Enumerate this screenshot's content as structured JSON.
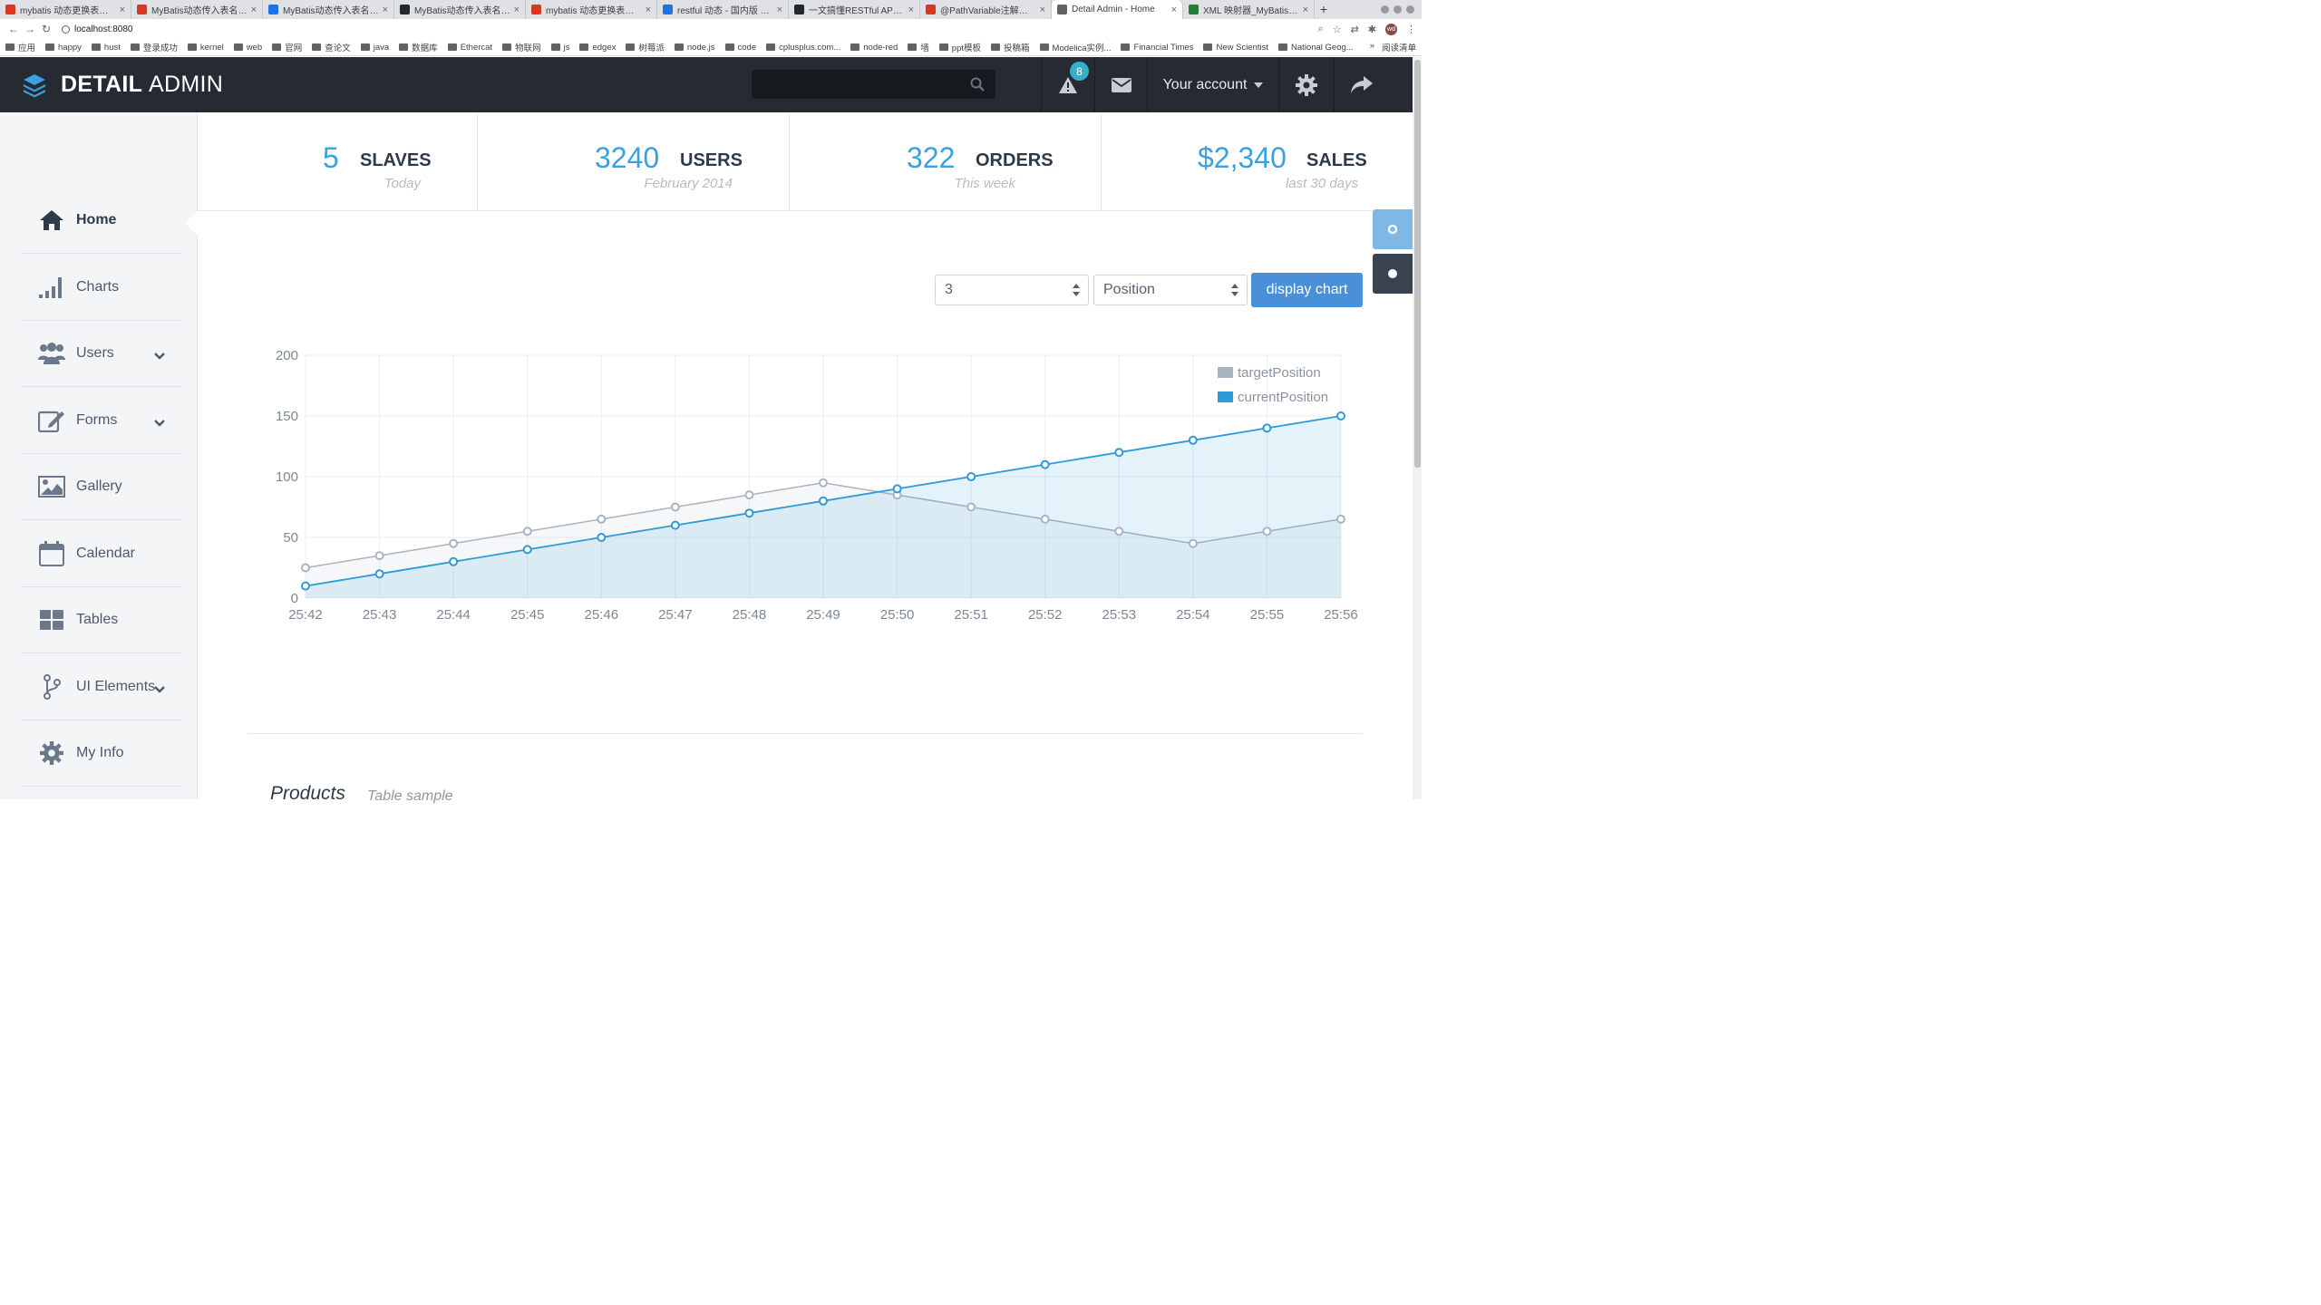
{
  "browser": {
    "tabs": [
      {
        "label": "mybatis 动态更换表名，J",
        "color": "#d9381e"
      },
      {
        "label": "MyBatis动态传入表名_da",
        "color": "#d9381e"
      },
      {
        "label": "MyBatis动态传入表名 - 图",
        "color": "#1a73e8"
      },
      {
        "label": "MyBatis动态传入表名 - cn",
        "color": "#24292e"
      },
      {
        "label": "mybatis 动态更换表名，J",
        "color": "#d9381e"
      },
      {
        "label": "restful 动态 - 国内版 Bing",
        "color": "#1a73e8"
      },
      {
        "label": "一文搞懂RESTful API - big",
        "color": "#24292e"
      },
      {
        "label": "@PathVariable注解使用_",
        "color": "#d9381e"
      },
      {
        "label": "Detail Admin - Home",
        "color": "#5f6368",
        "active": true
      },
      {
        "label": "XML 映射器_MyBatis中文",
        "color": "#1e7f3a"
      }
    ],
    "url": "localhost:8080",
    "bookmarks": [
      "应用",
      "happy",
      "hust",
      "登录成功",
      "kernel",
      "web",
      "官网",
      "查论文",
      "java",
      "数据库",
      "Ethercat",
      "物联网",
      "js",
      "edgex",
      "树莓派",
      "node.js",
      "code",
      "cplusplus.com...",
      "node-red",
      "墙",
      "ppt模板",
      "投稿箱",
      "Modelica实例...",
      "Financial Times",
      "New Scientist",
      "National Geog..."
    ],
    "bookmarks_more": "»",
    "reading_list": "阅读清单",
    "profile_initials": "wd"
  },
  "header": {
    "brand_bold": "DETAIL",
    "brand_light": "ADMIN",
    "search_placeholder": "",
    "alert_count": "8",
    "account_label": "Your account"
  },
  "sidebar": {
    "items": [
      {
        "label": "Home",
        "icon": "home-icon",
        "active": true
      },
      {
        "label": "Charts",
        "icon": "charts-icon"
      },
      {
        "label": "Users",
        "icon": "users-icon",
        "has_submenu": true
      },
      {
        "label": "Forms",
        "icon": "forms-icon",
        "has_submenu": true
      },
      {
        "label": "Gallery",
        "icon": "gallery-icon"
      },
      {
        "label": "Calendar",
        "icon": "calendar-icon"
      },
      {
        "label": "Tables",
        "icon": "tables-icon"
      },
      {
        "label": "UI Elements",
        "icon": "ui-elements-icon",
        "has_submenu": true
      },
      {
        "label": "My Info",
        "icon": "gear-icon"
      }
    ]
  },
  "stats": [
    {
      "value": "5",
      "label": "SLAVES",
      "sub": "Today"
    },
    {
      "value": "3240",
      "label": "USERS",
      "sub": "February 2014"
    },
    {
      "value": "322",
      "label": "ORDERS",
      "sub": "This week"
    },
    {
      "value": "$2,340",
      "label": "SALES",
      "sub": "last 30 days"
    }
  ],
  "controls": {
    "count_select": "3",
    "type_select": "Position",
    "display_button": "display chart"
  },
  "colors": {
    "accent": "#3aa0df",
    "header_bg": "#262b33",
    "button": "#4a90d9",
    "target_series": "#a9b4c2",
    "current_series": "#2e9ad8"
  },
  "chart_data": {
    "type": "line",
    "x": [
      "25:42",
      "25:43",
      "25:44",
      "25:45",
      "25:46",
      "25:47",
      "25:48",
      "25:49",
      "25:50",
      "25:51",
      "25:52",
      "25:53",
      "25:54",
      "25:55",
      "25:56"
    ],
    "ylim": [
      0,
      200
    ],
    "yticks": [
      0,
      50,
      100,
      150,
      200
    ],
    "grid": true,
    "legend_position": "top-right",
    "series": [
      {
        "name": "targetPosition",
        "values": [
          25,
          35,
          45,
          55,
          65,
          75,
          85,
          95,
          85,
          75,
          65,
          55,
          45,
          55,
          65
        ]
      },
      {
        "name": "currentPosition",
        "values": [
          10,
          20,
          30,
          40,
          50,
          60,
          70,
          80,
          90,
          100,
          110,
          120,
          130,
          140,
          150
        ]
      }
    ]
  },
  "products": {
    "title": "Products",
    "subtitle": "Table sample"
  }
}
